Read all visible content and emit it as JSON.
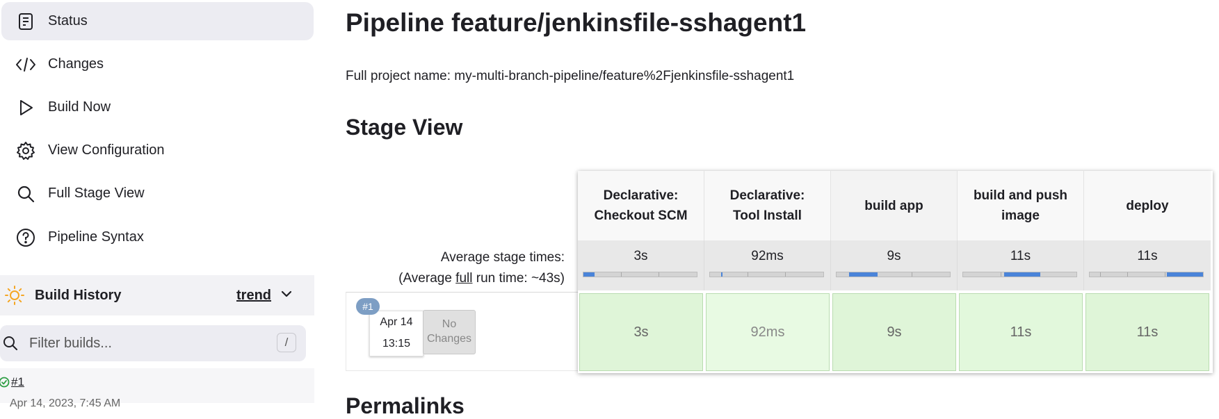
{
  "sidebar": {
    "items": [
      {
        "label": "Status",
        "icon": "document-icon"
      },
      {
        "label": "Changes",
        "icon": "code-icon"
      },
      {
        "label": "Build Now",
        "icon": "play-icon"
      },
      {
        "label": "View Configuration",
        "icon": "gear-icon"
      },
      {
        "label": "Full Stage View",
        "icon": "search-icon"
      },
      {
        "label": "Pipeline Syntax",
        "icon": "help-icon"
      }
    ],
    "active_item": "Status"
  },
  "build_history": {
    "title": "Build History",
    "trend_label": "trend",
    "filter_placeholder": "Filter builds...",
    "filter_shortcut": "/",
    "builds": [
      {
        "number": "#1",
        "date": "Apr 14, 2023, 7:45 AM",
        "status": "success"
      }
    ]
  },
  "main": {
    "title": "Pipeline feature/jenkinsfile-sshagent1",
    "full_project_name": "Full project name: my-multi-branch-pipeline/feature%2Fjenkinsfile-sshagent1",
    "stage_view_heading": "Stage View",
    "permalinks_heading": "Permalinks"
  },
  "stage_view": {
    "average_label": "Average stage times:",
    "full_run_prefix": "(Average ",
    "full_run_link": "full",
    "full_run_suffix": " run time: ~43s)",
    "stages": [
      {
        "name_line1": "Declarative:",
        "name_line2": "Checkout SCM",
        "avg": "3s",
        "bar_start": 0.0,
        "bar_fraction": 0.1
      },
      {
        "name_line1": "Declarative:",
        "name_line2": "Tool Install",
        "avg": "92ms",
        "bar_start": 0.1,
        "bar_fraction": 0.01
      },
      {
        "name_line1": "build app",
        "name_line2": "",
        "avg": "9s",
        "bar_start": 0.11,
        "bar_fraction": 0.25
      },
      {
        "name_line1": "build and push",
        "name_line2": "image",
        "avg": "11s",
        "bar_start": 0.36,
        "bar_fraction": 0.32
      },
      {
        "name_line1": "deploy",
        "name_line2": "",
        "avg": "11s",
        "bar_start": 0.68,
        "bar_fraction": 0.32
      }
    ],
    "runs": [
      {
        "badge": "#1",
        "date_line1": "Apr 14",
        "date_line2": "13:15",
        "changes_line1": "No",
        "changes_line2": "Changes",
        "durations": [
          "3s",
          "92ms",
          "9s",
          "11s",
          "11s"
        ]
      }
    ]
  },
  "colors": {
    "success_cell": "#dff5d8",
    "progress_fill": "#4a84d9",
    "active_item_bg": "#ececf2",
    "badge": "#7d9ec4",
    "sun_icon": "#f5a623"
  }
}
